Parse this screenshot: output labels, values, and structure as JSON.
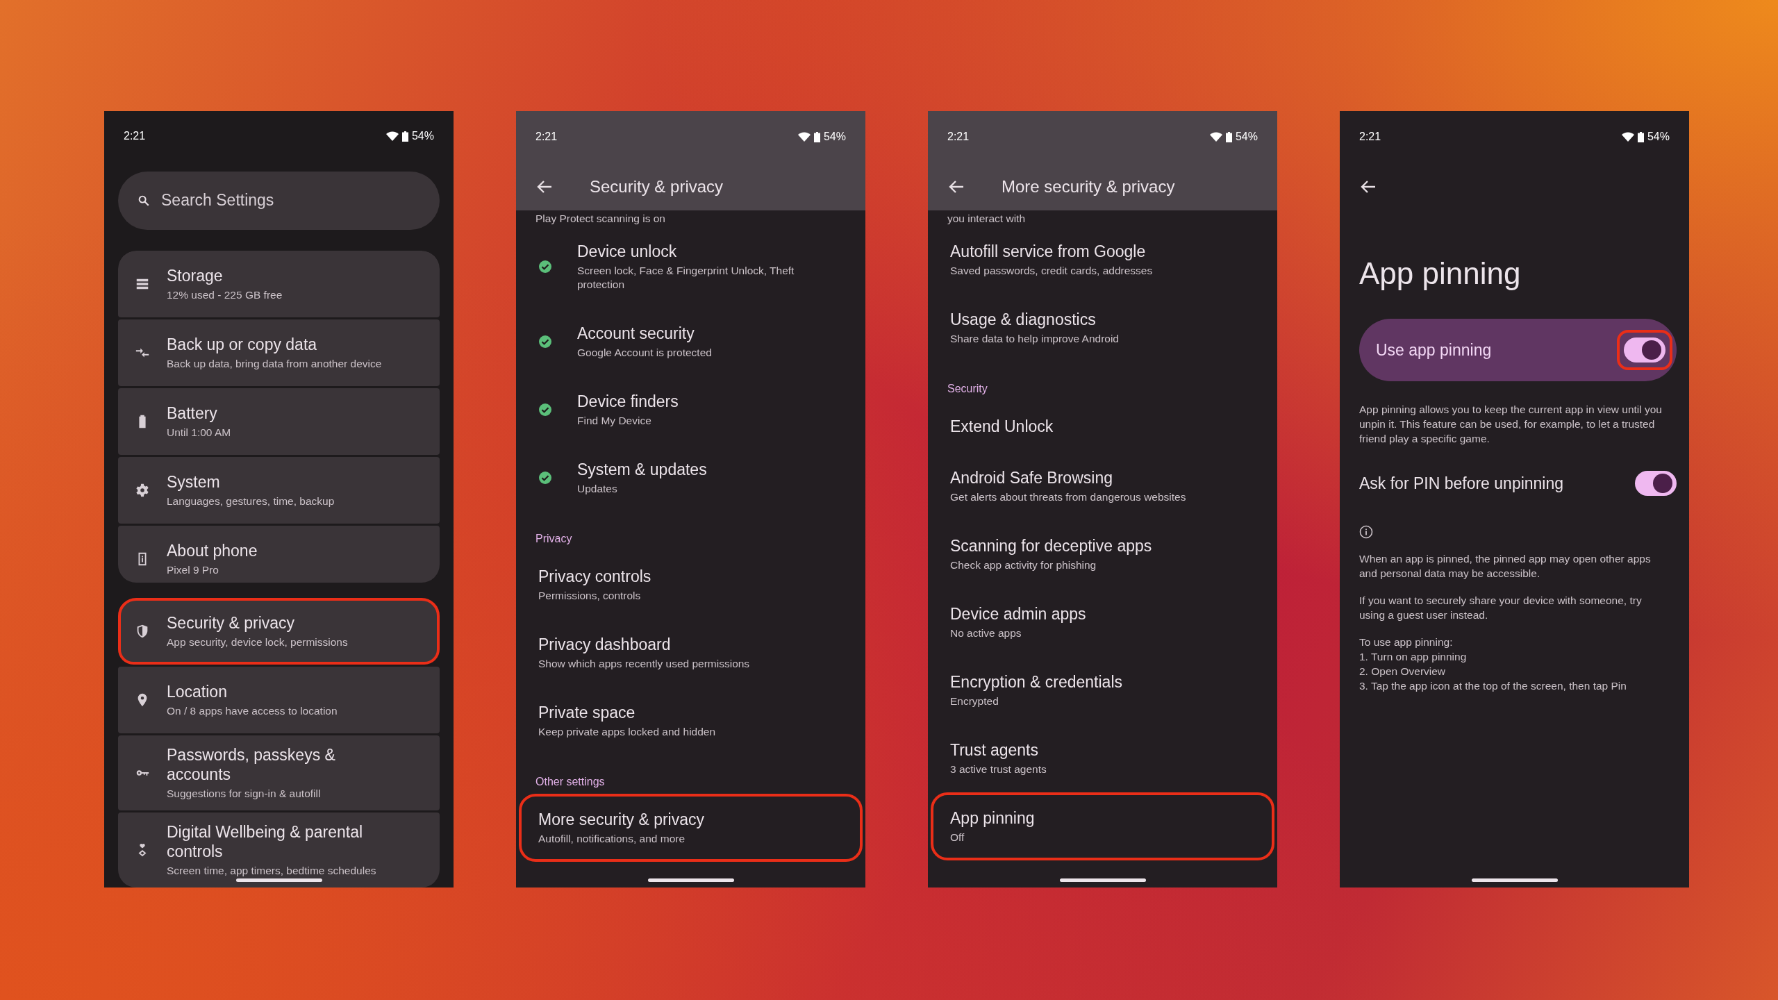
{
  "screens": [
    {
      "kind": "home",
      "status_bar": {
        "time": "2:21",
        "battery": "54%"
      },
      "search": {
        "placeholder": "Search Settings"
      },
      "groups": [
        {
          "items": [
            {
              "title": "Storage",
              "subtitle": "12% used - 225 GB free",
              "highlighted": false
            },
            {
              "title": "Back up or copy data",
              "subtitle": "Back up data, bring data from another device",
              "highlighted": false
            },
            {
              "title": "Battery",
              "subtitle": "Until 1:00 AM",
              "highlighted": false
            },
            {
              "title": "System",
              "subtitle": "Languages, gestures, time, backup",
              "highlighted": false
            },
            {
              "title": "About phone",
              "subtitle": "Pixel 9 Pro",
              "highlighted": false
            }
          ]
        },
        {
          "items": [
            {
              "title": "Security & privacy",
              "subtitle": "App security, device lock, permissions",
              "highlighted": true
            },
            {
              "title": "Location",
              "subtitle": "On / 8 apps have access to location",
              "highlighted": false
            },
            {
              "title": "Passwords, passkeys & accounts",
              "subtitle": "Suggestions for sign-in & autofill",
              "highlighted": false
            },
            {
              "title": "Digital Wellbeing & parental controls",
              "subtitle": "Screen time, app timers, bedtime schedules",
              "highlighted": false
            }
          ]
        }
      ]
    },
    {
      "kind": "list",
      "status_bar": {
        "time": "2:21",
        "battery": "54%"
      },
      "app_bar": {
        "title": "Security & privacy"
      },
      "items": [
        {
          "kind": "clipped",
          "text": "Play Protect scanning is on"
        },
        {
          "kind": "entry",
          "title": "Device unlock",
          "subtitle": "Screen lock, Face & Fingerprint Unlock, Theft protection",
          "verified": true,
          "highlighted": false
        },
        {
          "kind": "entry",
          "title": "Account security",
          "subtitle": "Google Account is protected",
          "verified": true,
          "highlighted": false
        },
        {
          "kind": "entry",
          "title": "Device finders",
          "subtitle": "Find My Device",
          "verified": true,
          "highlighted": false
        },
        {
          "kind": "entry",
          "title": "System & updates",
          "subtitle": "Updates",
          "verified": true,
          "highlighted": false
        },
        {
          "kind": "header",
          "text": "Privacy"
        },
        {
          "kind": "entry",
          "title": "Privacy controls",
          "subtitle": "Permissions, controls",
          "highlighted": false
        },
        {
          "kind": "entry",
          "title": "Privacy dashboard",
          "subtitle": "Show which apps recently used permissions",
          "highlighted": false
        },
        {
          "kind": "entry",
          "title": "Private space",
          "subtitle": "Keep private apps locked and hidden",
          "highlighted": false
        },
        {
          "kind": "header",
          "text": "Other settings"
        },
        {
          "kind": "entry",
          "title": "More security & privacy",
          "subtitle": "Autofill, notifications, and more",
          "highlighted": true
        }
      ]
    },
    {
      "kind": "list",
      "status_bar": {
        "time": "2:21",
        "battery": "54%"
      },
      "app_bar": {
        "title": "More security & privacy"
      },
      "items": [
        {
          "kind": "clipped",
          "text": "you interact with"
        },
        {
          "kind": "entry",
          "title": "Autofill service from Google",
          "subtitle": "Saved passwords, credit cards, addresses",
          "highlighted": false
        },
        {
          "kind": "entry",
          "title": "Usage & diagnostics",
          "subtitle": "Share data to help improve Android",
          "highlighted": false
        },
        {
          "kind": "header",
          "text": "Security"
        },
        {
          "kind": "entry",
          "title": "Extend Unlock",
          "highlighted": false
        },
        {
          "kind": "entry",
          "title": "Android Safe Browsing",
          "subtitle": "Get alerts about threats from dangerous websites",
          "highlighted": false
        },
        {
          "kind": "entry",
          "title": "Scanning for deceptive apps",
          "subtitle": "Check app activity for phishing",
          "highlighted": false
        },
        {
          "kind": "entry",
          "title": "Device admin apps",
          "subtitle": "No active apps",
          "highlighted": false
        },
        {
          "kind": "entry",
          "title": "Encryption & credentials",
          "subtitle": "Encrypted",
          "highlighted": false
        },
        {
          "kind": "entry",
          "title": "Trust agents",
          "subtitle": "3 active trust agents",
          "highlighted": false
        },
        {
          "kind": "entry",
          "title": "App pinning",
          "subtitle": "Off",
          "highlighted": true
        }
      ]
    },
    {
      "kind": "detail",
      "status_bar": {
        "time": "2:21",
        "battery": "54%"
      },
      "title": "App pinning",
      "main_switch": {
        "label": "Use app pinning",
        "on": true,
        "highlighted": true
      },
      "description": "App pinning allows you to keep the current app in view until you unpin it. This feature can be used, for example, to let a trusted friend play a specific game.",
      "switches": [
        {
          "label": "Ask for PIN before unpinning",
          "on": true
        }
      ],
      "notes": [
        "When an app is pinned, the pinned app may open other apps and personal data may be accessible.",
        "If you want to securely share your device with someone, try using a guest user instead.",
        "To use app pinning:\n1. Turn on app pinning\n2. Open Overview\n3. Tap the app icon at the top of the screen, then tap Pin"
      ]
    }
  ]
}
